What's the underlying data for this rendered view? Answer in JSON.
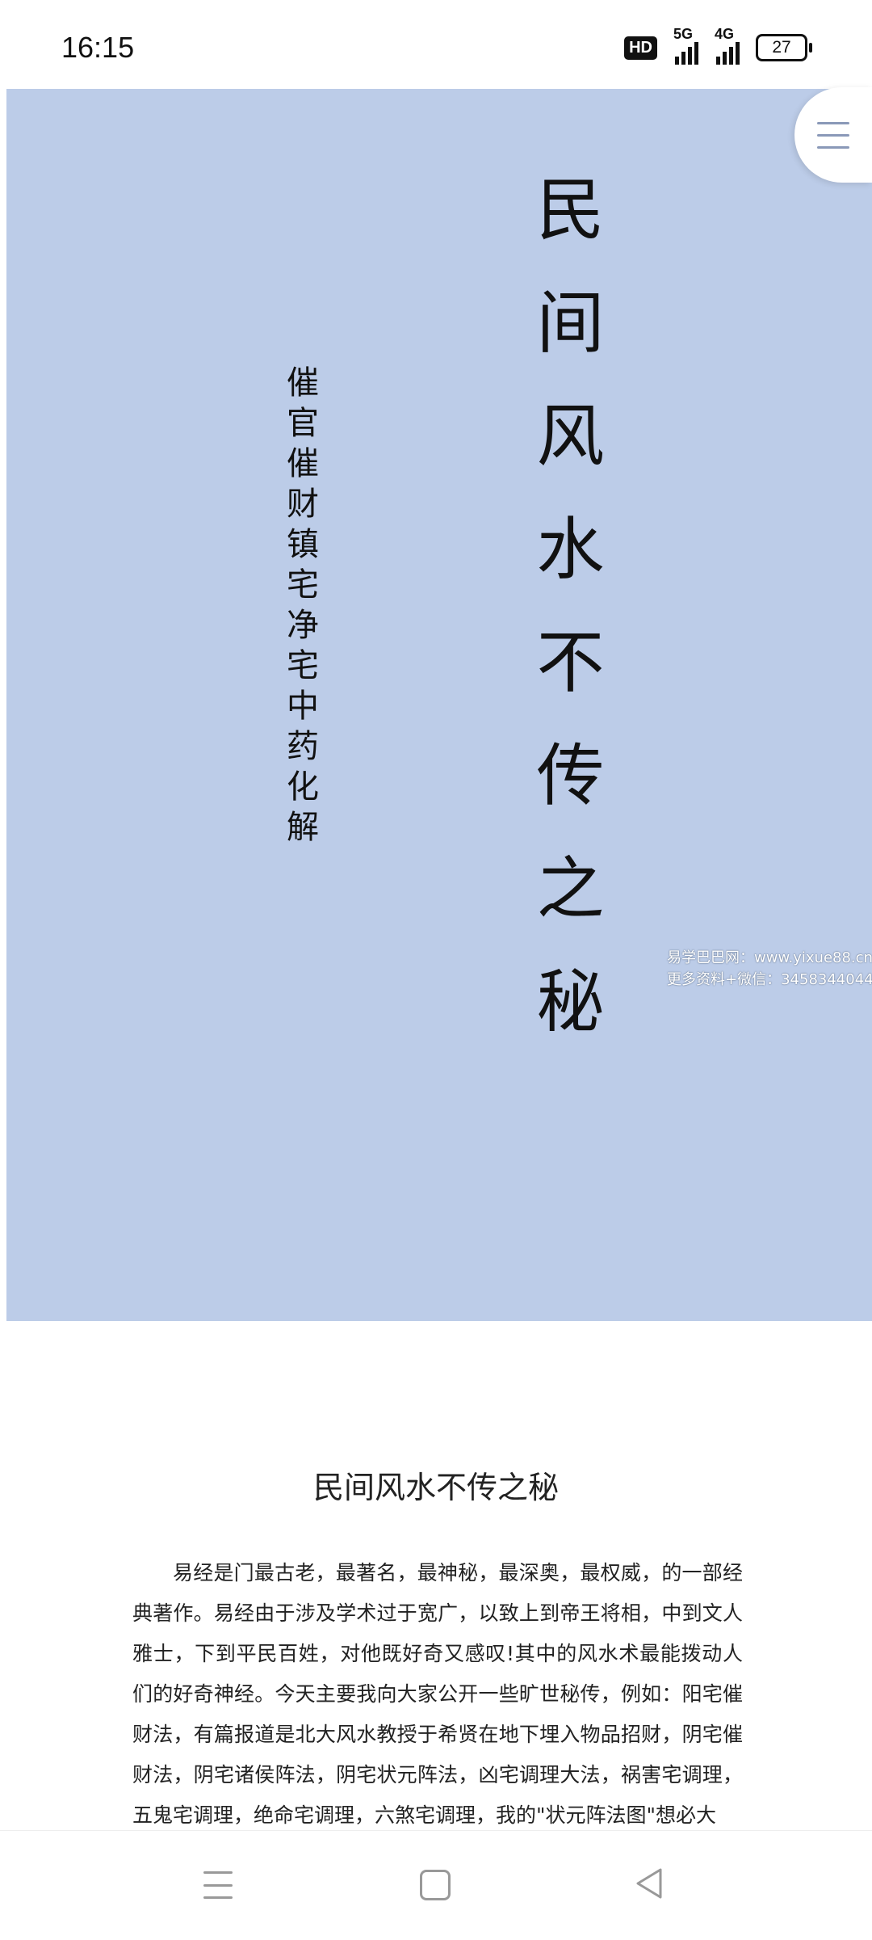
{
  "status_bar": {
    "time": "16:15",
    "hd": "HD",
    "net1": "5G",
    "net2": "4G",
    "battery": "27"
  },
  "cover": {
    "background": "#bccce8",
    "title": "民间风水不传之秘",
    "subtitle": "催官催财镇宅净宅中药化解",
    "watermark_line1": "易学巴巴网：www.yixue88.cn",
    "watermark_line2": "更多资料+微信：3458344044"
  },
  "article": {
    "title": "民间风水不传之秘",
    "body": "易经是门最古老，最著名，最神秘，最深奥，最权威，的一部经典著作。易经由于涉及学术过于宽广，以致上到帝王将相，中到文人雅士，下到平民百姓，对他既好奇又感叹!其中的风水术最能拨动人们的好奇神经。今天主要我向大家公开一些旷世秘传，例如：阳宅催财法，有篇报道是北大风水教授于希贤在地下埋入物品招财，阴宅催财法，阴宅诸侯阵法，阴宅状元阵法，凶宅调理大法，祸害宅调理，五鬼宅调理，绝命宅调理，六煞宅调理，我的\"状元阵法图\"想必大"
  },
  "nav": {
    "menu_icon": "menu-icon",
    "home_icon": "home-icon",
    "back_icon": "back-icon"
  }
}
